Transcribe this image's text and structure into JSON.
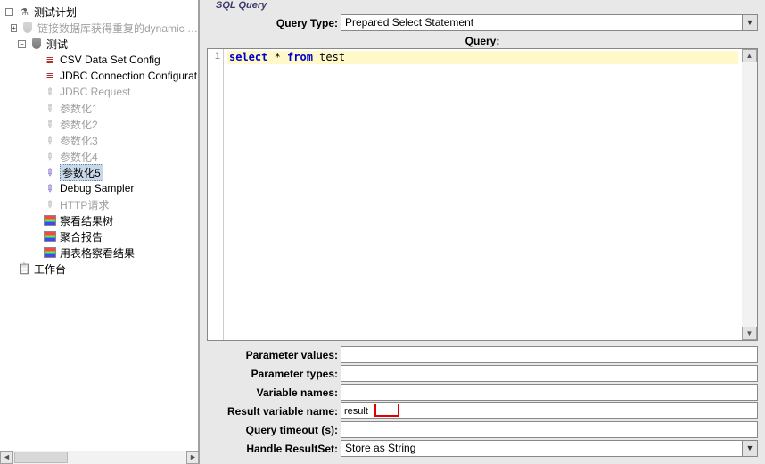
{
  "tree": {
    "root": "测试计划",
    "disabled1": "链接数据库获得重复的dynamic …",
    "thread": "测试",
    "items": [
      {
        "label": "CSV Data Set Config",
        "icon": "ic-csv",
        "gray": false
      },
      {
        "label": "JDBC Connection Configurat",
        "icon": "ic-csv",
        "gray": false
      },
      {
        "label": "JDBC Request",
        "icon": "ic-pencil-gray",
        "gray": true
      },
      {
        "label": "参数化1",
        "icon": "ic-pencil-gray",
        "gray": true
      },
      {
        "label": "参数化2",
        "icon": "ic-pencil-gray",
        "gray": true
      },
      {
        "label": "参数化3",
        "icon": "ic-pencil-gray",
        "gray": true
      },
      {
        "label": "参数化4",
        "icon": "ic-pencil-gray",
        "gray": true
      },
      {
        "label": "参数化5",
        "icon": "ic-pencil",
        "gray": false,
        "selected": true
      },
      {
        "label": "Debug Sampler",
        "icon": "ic-pencil",
        "gray": false
      },
      {
        "label": "HTTP请求",
        "icon": "ic-pencil-gray",
        "gray": true
      },
      {
        "label": "察看结果树",
        "icon": "ic-result",
        "gray": false
      },
      {
        "label": "聚合报告",
        "icon": "ic-result",
        "gray": false
      },
      {
        "label": "用表格察看结果",
        "icon": "ic-result",
        "gray": false
      }
    ],
    "workbench": "工作台"
  },
  "panel": {
    "section_title": "SQL Query",
    "query_type_label": "Query Type:",
    "query_type_value": "Prepared Select Statement",
    "query_header": "Query:",
    "gutter_line": "1",
    "code_kw1": "select",
    "code_op": " * ",
    "code_kw2": "from",
    "code_rest": " test",
    "param_values_label": "Parameter values:",
    "param_values": "",
    "param_types_label": "Parameter types:",
    "param_types": "",
    "variable_names_label": "Variable names:",
    "variable_names": "",
    "result_var_label": "Result variable name:",
    "result_var": "result",
    "query_timeout_label": "Query timeout (s):",
    "query_timeout": "",
    "handle_rs_label": "Handle ResultSet:",
    "handle_rs_value": "Store as String"
  },
  "scroll": {
    "left": "◄",
    "right": "►",
    "up": "▲",
    "down": "▼",
    "combo_arrow": "▼"
  }
}
